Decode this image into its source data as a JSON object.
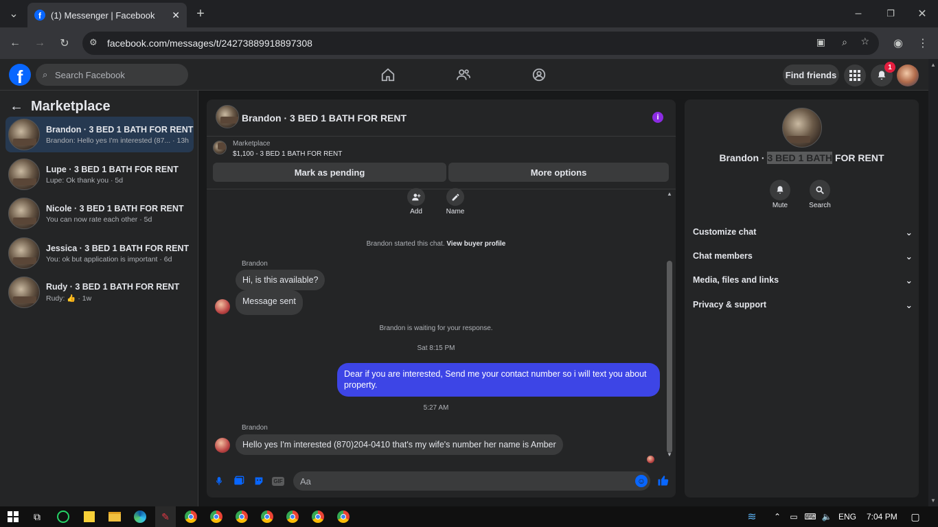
{
  "browser": {
    "tab_title": "(1) Messenger | Facebook",
    "url": "facebook.com/messages/t/24273889918897308"
  },
  "fb_header": {
    "search_placeholder": "Search Facebook",
    "find_friends": "Find friends",
    "notification_count": "1"
  },
  "sidebar": {
    "title": "Marketplace",
    "conversations": [
      {
        "title": "Brandon · 3 BED 1 BATH FOR RENT",
        "preview": "Brandon: Hello yes I'm interested (87... · 13h"
      },
      {
        "title": "Lupe · 3 BED 1 BATH FOR RENT",
        "preview": "Lupe: Ok thank you · 5d"
      },
      {
        "title": "Nicole · 3 BED 1 BATH FOR RENT",
        "preview": "You can now rate each other · 5d"
      },
      {
        "title": "Jessica · 3 BED 1 BATH FOR RENT",
        "preview": "You: ok but application is important · 6d"
      },
      {
        "title": "Rudy · 3 BED 1 BATH FOR RENT",
        "preview_prefix": "Rudy: ",
        "preview_suffix": " · 1w"
      }
    ]
  },
  "chat": {
    "title": "Brandon · 3 BED 1 BATH FOR RENT",
    "listing_source": "Marketplace",
    "listing_price_title": "$1,100 - 3 BED 1 BATH FOR RENT",
    "mark_pending": "Mark as pending",
    "more_options": "More options",
    "add_label": "Add",
    "name_label": "Name",
    "started_text": "Brandon started this chat.",
    "view_buyer_profile": "View buyer profile",
    "sender_name_1": "Brandon",
    "msg_1": "Hi, is this available?",
    "msg_2": "Message sent",
    "waiting_text": "Brandon is waiting for your response.",
    "time_1": "Sat 8:15 PM",
    "msg_3": "Dear if you are interested, Send me your contact number so i will text you about property.",
    "time_2": "5:27 AM",
    "sender_name_2": "Brandon",
    "msg_4": "Hello yes I'm interested (870)204-0410 that's my wife's number her name is Amber",
    "composer_placeholder": "Aa",
    "accent": "#3d45e6"
  },
  "info_panel": {
    "name_prefix": "Brandon · ",
    "name_highlight": "3 BED 1 BATH",
    "name_suffix": " FOR RENT",
    "mute": "Mute",
    "search": "Search",
    "sections": [
      "Customize chat",
      "Chat members",
      "Media, files and links",
      "Privacy & support"
    ]
  },
  "taskbar": {
    "lang": "ENG",
    "time": "7:04 PM"
  }
}
